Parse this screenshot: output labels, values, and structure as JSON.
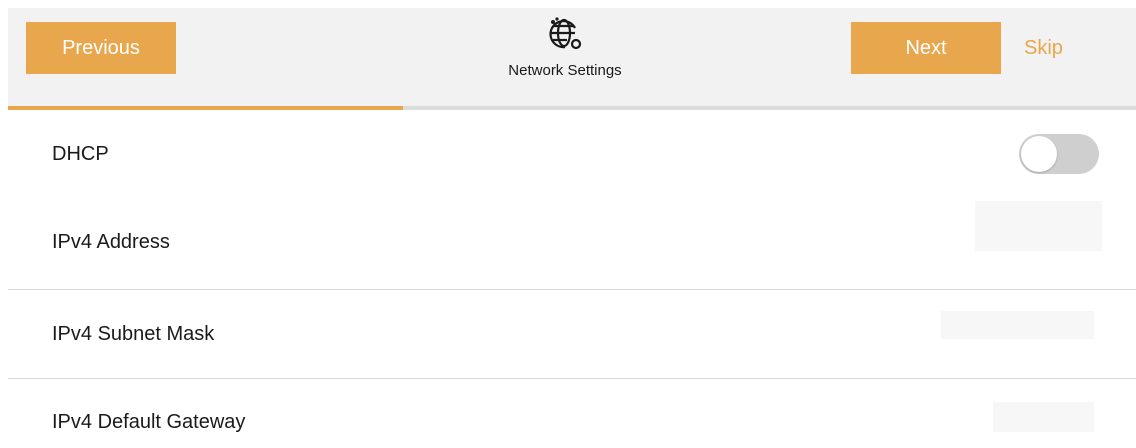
{
  "header": {
    "previous_label": "Previous",
    "next_label": "Next",
    "skip_label": "Skip",
    "title": "Network Settings",
    "icon": "globe-network-icon",
    "progress_percent": 35
  },
  "settings": {
    "dhcp": {
      "label": "DHCP",
      "enabled": false
    },
    "ipv4_address": {
      "label": "IPv4 Address",
      "value": ""
    },
    "subnet_mask": {
      "label": "IPv4 Subnet Mask",
      "value": ""
    },
    "default_gateway": {
      "label": "IPv4 Default Gateway",
      "value": ""
    }
  },
  "colors": {
    "accent": "#e8a74d",
    "header_bg": "#f2f2f2",
    "toggle_off": "#cfcfcf"
  }
}
